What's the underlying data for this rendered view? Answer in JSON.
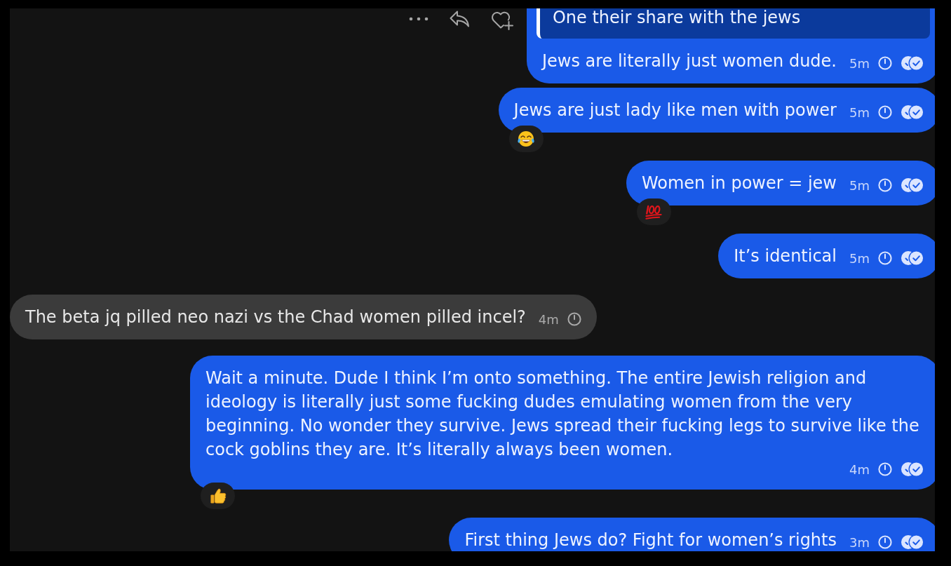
{
  "messages": [
    {
      "kind": "sent",
      "hovered": true,
      "quote": "One their share with the jews",
      "text": "Jews are literally just women dude.",
      "time": "5m",
      "read": true
    },
    {
      "kind": "sent",
      "hovered": false,
      "text": "Jews are just lady like men with power",
      "time": "5m",
      "read": true,
      "reaction": {
        "kind": "tears_of_joy"
      }
    },
    {
      "kind": "sent",
      "hovered": false,
      "text": "Women in power = jew",
      "time": "5m",
      "read": true,
      "reaction": {
        "kind": "hundred_points"
      }
    },
    {
      "kind": "sent",
      "hovered": false,
      "text": "It’s identical",
      "time": "5m",
      "read": true
    },
    {
      "kind": "received",
      "hovered": false,
      "text": "The beta jq pilled neo nazi vs the Chad women pilled incel?",
      "time": "4m",
      "read": false
    },
    {
      "kind": "sent",
      "hovered": false,
      "text": "Wait a minute. Dude I think I’m onto something. The entire Jewish religion and ideology is literally just some fucking dudes emulating women from the very beginning. No wonder they survive. Jews spread their fucking legs to survive like the cock goblins they are. It’s literally always been women.",
      "time": "4m",
      "read": true,
      "reaction": {
        "kind": "thumbs_up"
      }
    },
    {
      "kind": "sent",
      "hovered": false,
      "text": "First thing Jews do? Fight for women’s rights",
      "time": "3m",
      "read": true
    }
  ]
}
